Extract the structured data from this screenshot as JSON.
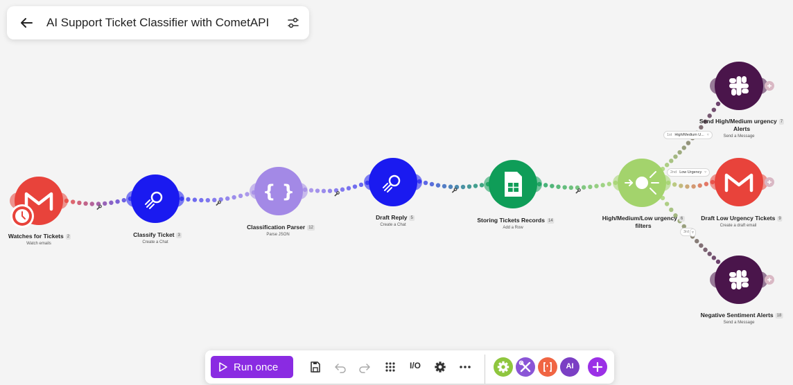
{
  "header": {
    "title": "AI Support Ticket Classifier with CometAPI",
    "back_icon": "arrow-left-icon",
    "settings_icon": "sliders-icon"
  },
  "nodes": [
    {
      "id": "watch",
      "label": "Watches for Tickets",
      "badge": "2",
      "subtitle": "Watch emails",
      "app": "gmail",
      "color": "#e8433b",
      "has_clock": true
    },
    {
      "id": "classify",
      "label": "Classify Ticket",
      "badge": "3",
      "subtitle": "Create a Chat",
      "app": "cometapi",
      "color": "#1a1af0"
    },
    {
      "id": "parser",
      "label": "Classification Parser",
      "badge": "12",
      "subtitle": "Parse JSON",
      "app": "json",
      "color": "#a389e6"
    },
    {
      "id": "draft",
      "label": "Draft Reply",
      "badge": "5",
      "subtitle": "Create a Chat",
      "app": "cometapi",
      "color": "#1a1af0"
    },
    {
      "id": "sheets",
      "label": "Storing Tickets Records",
      "badge": "14",
      "subtitle": "Add a Row",
      "app": "google-sheets",
      "color": "#0f9d58"
    },
    {
      "id": "router",
      "label_line1": "High/Medium/Low urgency",
      "label_line2": "filters",
      "badge": "6",
      "app": "router",
      "color": "#a3d36c"
    },
    {
      "id": "slack-alerts",
      "label_line1": "Send High/Medium urgency",
      "label_line2": "Alerts",
      "badge": "7",
      "subtitle": "Send a Message",
      "app": "slack",
      "color": "#4a154b"
    },
    {
      "id": "gmail-draft",
      "label": "Draft Low Urgency Tickets",
      "badge": "9",
      "subtitle": "Create a draft email",
      "app": "gmail",
      "color": "#e8433b"
    },
    {
      "id": "slack-negative",
      "label": "Negative Sentiment Alerts",
      "badge": "18",
      "subtitle": "Send a Message",
      "app": "slack",
      "color": "#4a154b"
    }
  ],
  "routes": [
    {
      "order": "1st",
      "label": "High/Medium U..."
    },
    {
      "order": "2nd",
      "label": "Low Urgency"
    },
    {
      "order": "3rd",
      "label": ""
    }
  ],
  "toolbar": {
    "run_label": "Run once",
    "io_label": "I/O",
    "ai_label": "AI",
    "icons": [
      "play-icon",
      "save-icon",
      "undo-icon",
      "redo-icon",
      "grid-icon",
      "settings-icon",
      "more-icon",
      "gear-icon",
      "tools-icon",
      "brackets-icon",
      "plus-icon"
    ]
  },
  "colors": {
    "accent": "#8a2be2",
    "gmail": "#e8433b",
    "cometapi": "#1a1af0",
    "json": "#a389e6",
    "sheets": "#0f9d58",
    "router": "#a3d36c",
    "slack": "#4a154b"
  }
}
